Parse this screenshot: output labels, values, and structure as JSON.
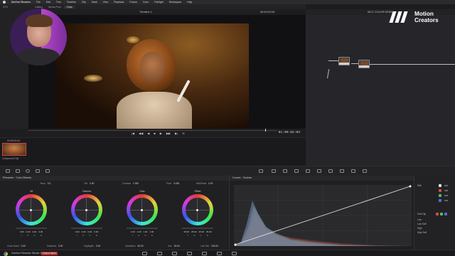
{
  "menubar": {
    "app_name": "DaVinci Resolve",
    "items": [
      "File",
      "Edit",
      "Trim",
      "Timeline",
      "Clip",
      "Mark",
      "View",
      "Playback",
      "Fusion",
      "Color",
      "Fairlight",
      "Workspace",
      "Help"
    ]
  },
  "toolbar": {
    "zoom": "37%",
    "tabs": [
      "Gallery",
      "Media Pool",
      "Clips"
    ],
    "active_tab": "Clips"
  },
  "viewer": {
    "title": "Timeline 1",
    "timecode_top": "00:00:02:03",
    "timecode_main": "01:00:02:03"
  },
  "transport": {
    "controls": [
      "|◀",
      "◀◀",
      "◀",
      "■",
      "▶",
      "▶▶",
      "▶|",
      "⟲"
    ]
  },
  "clips": {
    "timecode": "00:00:00:00",
    "clip_label": "Compound Clip"
  },
  "node_editor": {
    "title": "MCC COLOR DEMO"
  },
  "brand": {
    "line1": "Motion",
    "line2": "Creators"
  },
  "primaries": {
    "title": "Primaries · Color Wheels",
    "top_adjustments": [
      {
        "label": "Temp",
        "value": "0.0"
      },
      {
        "label": "Tint",
        "value": "0.00"
      },
      {
        "label": "Contrast",
        "value": "1.000"
      },
      {
        "label": "Pivot",
        "value": "0.435"
      },
      {
        "label": "Mid/Detail",
        "value": "0.00"
      }
    ],
    "wheels": [
      {
        "name": "Lift",
        "values": [
          "0.00",
          "0.00",
          "0.00",
          "0.00"
        ]
      },
      {
        "name": "Gamma",
        "values": [
          "0.00",
          "0.00",
          "0.00",
          "0.00"
        ]
      },
      {
        "name": "Gain",
        "values": [
          "1.00",
          "1.00",
          "1.00",
          "1.00"
        ]
      },
      {
        "name": "Offset",
        "values": [
          "25.00",
          "25.00",
          "25.00",
          "25.00"
        ]
      }
    ],
    "rgb_labels": [
      "Y",
      "R",
      "G",
      "B"
    ],
    "bottom_adjustments": [
      {
        "label": "Color Boost",
        "value": "0.00"
      },
      {
        "label": "Shadows",
        "value": "0.00"
      },
      {
        "label": "Highlights",
        "value": "0.00"
      },
      {
        "label": "Saturation",
        "value": "50.00"
      },
      {
        "label": "Hue",
        "value": "50.00"
      },
      {
        "label": "Lum Mix",
        "value": "100.00"
      }
    ]
  },
  "curves": {
    "title": "Curves · Custom",
    "edit_label": "Edit",
    "channel_values": [
      "100",
      "100",
      "100",
      "100"
    ],
    "soft_clip_label": "Soft Clip",
    "soft_clip_rows": [
      "Low",
      "Low Soft",
      "High",
      "High Soft"
    ]
  },
  "status": {
    "app": "DaVinci Resolve Studio 18",
    "badge": "PUBLIC BETA"
  },
  "colors": {
    "accent_red": "#c4484a",
    "node_highlight": "#cfcfcf",
    "curve_line": "#e0e0e0"
  }
}
